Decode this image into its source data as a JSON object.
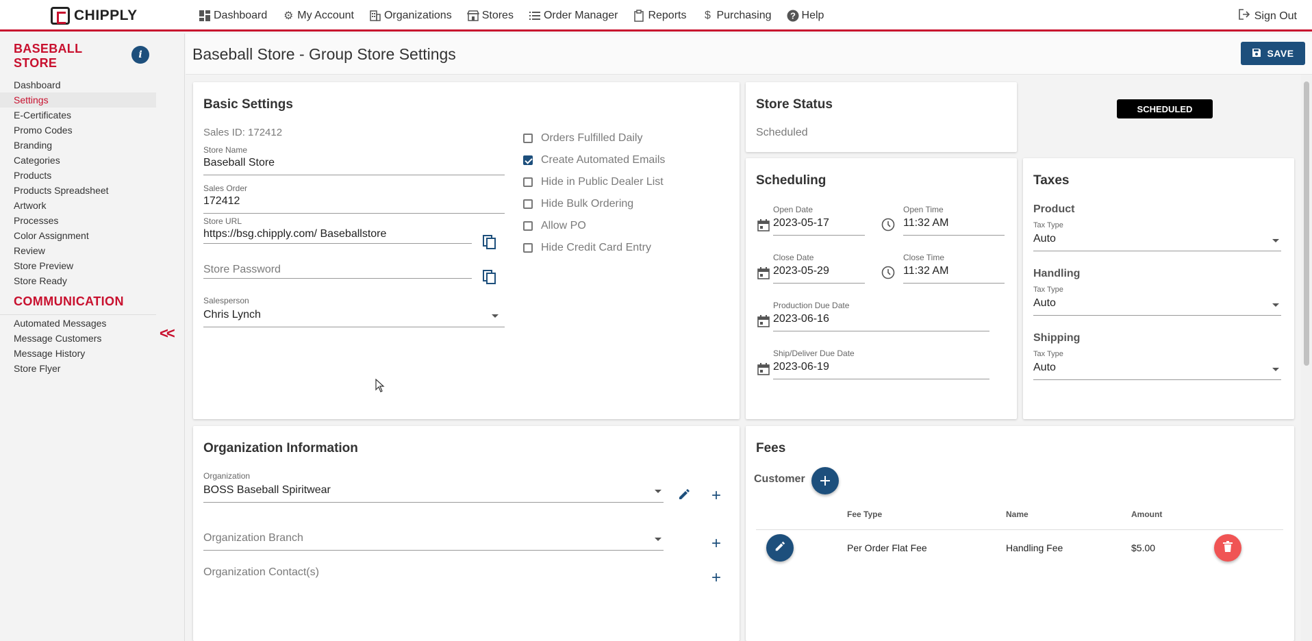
{
  "nav": {
    "logo": "CHIPPLY",
    "items": [
      {
        "label": "Dashboard",
        "icon": "dashboard-icon"
      },
      {
        "label": "My Account",
        "icon": "gear-icon"
      },
      {
        "label": "Organizations",
        "icon": "building-icon"
      },
      {
        "label": "Stores",
        "icon": "store-icon"
      },
      {
        "label": "Order Manager",
        "icon": "list-icon"
      },
      {
        "label": "Reports",
        "icon": "clipboard-icon"
      },
      {
        "label": "Purchasing",
        "icon": "dollar-icon"
      },
      {
        "label": "Help",
        "icon": "help-icon"
      }
    ],
    "sign_out": "Sign Out"
  },
  "sidebar": {
    "store_title": "BASEBALL STORE",
    "items": [
      {
        "label": "Dashboard"
      },
      {
        "label": "Settings"
      },
      {
        "label": "E-Certificates"
      },
      {
        "label": "Promo Codes"
      },
      {
        "label": "Branding"
      },
      {
        "label": "Categories"
      },
      {
        "label": "Products"
      },
      {
        "label": "Products Spreadsheet"
      },
      {
        "label": "Artwork"
      },
      {
        "label": "Processes"
      },
      {
        "label": "Color Assignment"
      },
      {
        "label": "Review"
      },
      {
        "label": "Store Preview"
      },
      {
        "label": "Store Ready"
      }
    ],
    "section_title": "COMMUNICATION",
    "comm_items": [
      {
        "label": "Automated Messages"
      },
      {
        "label": "Message Customers"
      },
      {
        "label": "Message History"
      },
      {
        "label": "Store Flyer"
      }
    ],
    "collapse_label": "<<"
  },
  "header": {
    "title": "Baseball Store - Group Store Settings",
    "save_label": "SAVE"
  },
  "basic": {
    "title": "Basic Settings",
    "sales_id": "Sales ID: 172412",
    "store_name_label": "Store Name",
    "store_name": "Baseball Store",
    "sales_order_label": "Sales Order",
    "sales_order": "172412",
    "store_url_label": "Store URL",
    "store_url": "https://bsg.chipply.com/ Baseballstore",
    "store_password_placeholder": "Store Password",
    "salesperson_label": "Salesperson",
    "salesperson": "Chris Lynch",
    "checkboxes": [
      {
        "label": "Orders Fulfilled Daily",
        "checked": false
      },
      {
        "label": "Create Automated Emails",
        "checked": true
      },
      {
        "label": "Hide in Public Dealer List",
        "checked": false
      },
      {
        "label": "Hide Bulk Ordering",
        "checked": false
      },
      {
        "label": "Allow PO",
        "checked": false
      },
      {
        "label": "Hide Credit Card Entry",
        "checked": false
      }
    ]
  },
  "status": {
    "title": "Store Status",
    "value": "Scheduled",
    "badge": "SCHEDULED"
  },
  "scheduling": {
    "title": "Scheduling",
    "open_date_label": "Open Date",
    "open_date": "2023-05-17",
    "open_time_label": "Open Time",
    "open_time": "11:32 AM",
    "close_date_label": "Close Date",
    "close_date": "2023-05-29",
    "close_time_label": "Close Time",
    "close_time": "11:32 AM",
    "production_label": "Production Due Date",
    "production_date": "2023-06-16",
    "ship_label": "Ship/Deliver Due Date",
    "ship_date": "2023-06-19"
  },
  "taxes": {
    "title": "Taxes",
    "groups": [
      {
        "heading": "Product",
        "label": "Tax Type",
        "value": "Auto"
      },
      {
        "heading": "Handling",
        "label": "Tax Type",
        "value": "Auto"
      },
      {
        "heading": "Shipping",
        "label": "Tax Type",
        "value": "Auto"
      }
    ]
  },
  "org": {
    "title": "Organization Information",
    "org_label": "Organization",
    "org_value": "BOSS Baseball Spiritwear",
    "branch_placeholder": "Organization Branch",
    "contacts_placeholder": "Organization Contact(s)"
  },
  "fees": {
    "title": "Fees",
    "customer_label": "Customer",
    "columns": [
      "Fee Type",
      "Name",
      "Amount"
    ],
    "rows": [
      {
        "fee_type": "Per Order Flat Fee",
        "name": "Handling Fee",
        "amount": "$5.00"
      }
    ]
  },
  "colors": {
    "accent": "#c8102e",
    "primary": "#1d4f7c",
    "delete": "#f05454"
  }
}
